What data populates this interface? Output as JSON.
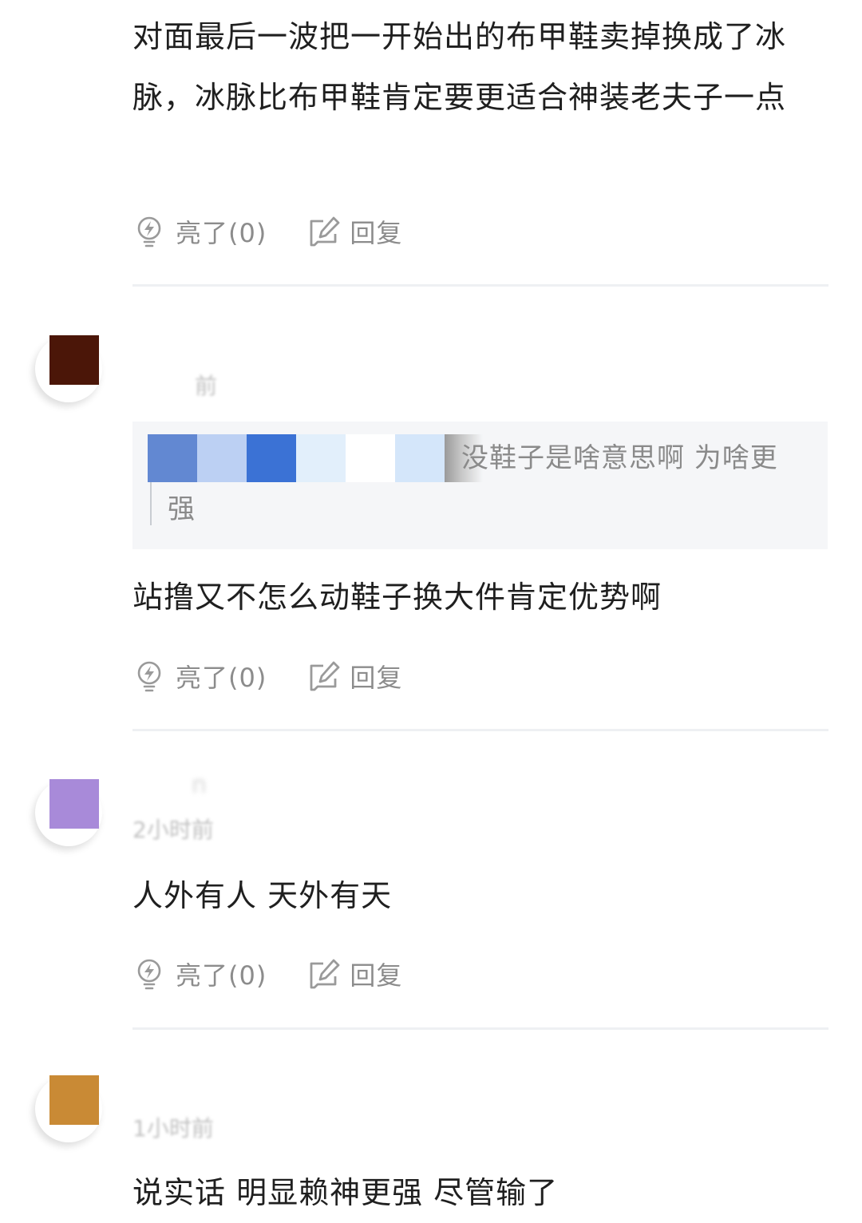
{
  "comments": [
    {
      "text": "对面最后一波把一开始出的布甲鞋卖掉换成了冰脉，冰脉比布甲鞋肯定要更适合神装老夫子一点",
      "like_label": "亮了(0)",
      "reply_label": "回复"
    },
    {
      "avatar_color": "#4b1608",
      "time": "前",
      "quote_text_l1": "没鞋子是啥意思啊 为啥更",
      "quote_text_l2": "强",
      "text": "站撸又不怎么动鞋子换大件肯定优势啊",
      "like_label": "亮了(0)",
      "reply_label": "回复"
    },
    {
      "avatar_color": "#a88ad9",
      "username": "n",
      "time": "2小时前",
      "text": "人外有人 天外有天",
      "like_label": "亮了(0)",
      "reply_label": "回复"
    },
    {
      "avatar_color": "#c98a35",
      "time": "1小时前",
      "text": "说实话 明显赖神更强 尽管输了"
    }
  ],
  "icons": {
    "like": "lightbulb-icon",
    "reply": "edit-reply-icon"
  },
  "colors": {
    "text": "#1f1f1f",
    "muted": "#8c8c8c",
    "divider": "#eef0f3",
    "quote_bg": "#f5f6f8",
    "mosaic": [
      "#6288d2",
      "#bcd0f3",
      "#3b72d5",
      "#e2effb",
      "#ffffff",
      "#d4e6fa",
      "#9a9a9a"
    ]
  }
}
